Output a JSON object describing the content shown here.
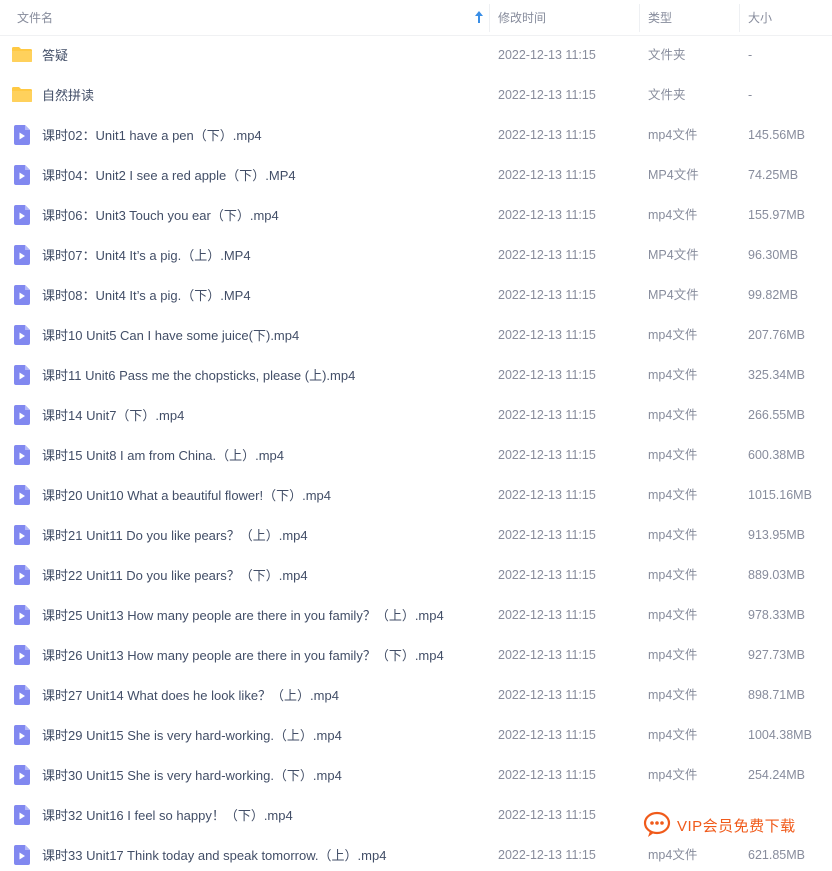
{
  "header": {
    "name_label": "文件名",
    "time_label": "修改时间",
    "type_label": "类型",
    "size_label": "大小",
    "sort_direction": "ascending"
  },
  "colors": {
    "folder": "#ffc943",
    "video_icon": "#8188f0",
    "name_text": "#424e67",
    "meta_text": "#878c9c",
    "sort_arrow": "#3a8ee6",
    "watermark": "#f05a1a"
  },
  "files": [
    {
      "kind": "folder",
      "icon": "folder-icon",
      "name": "答疑",
      "time": "2022-12-13 11:15",
      "type": "文件夹",
      "size": "-"
    },
    {
      "kind": "folder",
      "icon": "folder-icon",
      "name": "自然拼读",
      "time": "2022-12-13 11:15",
      "type": "文件夹",
      "size": "-"
    },
    {
      "kind": "video",
      "icon": "video-file-icon",
      "name": "课时02：Unit1 have a pen（下）.mp4",
      "time": "2022-12-13 11:15",
      "type": "mp4文件",
      "size": "145.56MB"
    },
    {
      "kind": "video",
      "icon": "video-file-icon",
      "name": "课时04：Unit2 I see a red apple（下）.MP4",
      "time": "2022-12-13 11:15",
      "type": "MP4文件",
      "size": "74.25MB"
    },
    {
      "kind": "video",
      "icon": "video-file-icon",
      "name": "课时06：Unit3 Touch you ear（下）.mp4",
      "time": "2022-12-13 11:15",
      "type": "mp4文件",
      "size": "155.97MB"
    },
    {
      "kind": "video",
      "icon": "video-file-icon",
      "name": "课时07：Unit4 It’s a pig.（上）.MP4",
      "time": "2022-12-13 11:15",
      "type": "MP4文件",
      "size": "96.30MB"
    },
    {
      "kind": "video",
      "icon": "video-file-icon",
      "name": "课时08：Unit4 It’s a pig.（下）.MP4",
      "time": "2022-12-13 11:15",
      "type": "MP4文件",
      "size": "99.82MB"
    },
    {
      "kind": "video",
      "icon": "video-file-icon",
      "name": "课时10 Unit5 Can I have some juice(下).mp4",
      "time": "2022-12-13 11:15",
      "type": "mp4文件",
      "size": "207.76MB"
    },
    {
      "kind": "video",
      "icon": "video-file-icon",
      "name": "课时11 Unit6 Pass me the chopsticks, please (上).mp4",
      "time": "2022-12-13 11:15",
      "type": "mp4文件",
      "size": "325.34MB"
    },
    {
      "kind": "video",
      "icon": "video-file-icon",
      "name": "课时14 Unit7（下）.mp4",
      "time": "2022-12-13 11:15",
      "type": "mp4文件",
      "size": "266.55MB"
    },
    {
      "kind": "video",
      "icon": "video-file-icon",
      "name": "课时15 Unit8 I am from China.（上）.mp4",
      "time": "2022-12-13 11:15",
      "type": "mp4文件",
      "size": "600.38MB"
    },
    {
      "kind": "video",
      "icon": "video-file-icon",
      "name": "课时20 Unit10 What a beautiful flower!（下）.mp4",
      "time": "2022-12-13 11:15",
      "type": "mp4文件",
      "size": "1015.16MB"
    },
    {
      "kind": "video",
      "icon": "video-file-icon",
      "name": "课时21 Unit11 Do you like pears？（上）.mp4",
      "time": "2022-12-13 11:15",
      "type": "mp4文件",
      "size": "913.95MB"
    },
    {
      "kind": "video",
      "icon": "video-file-icon",
      "name": "课时22 Unit11 Do you like pears？（下）.mp4",
      "time": "2022-12-13 11:15",
      "type": "mp4文件",
      "size": "889.03MB"
    },
    {
      "kind": "video",
      "icon": "video-file-icon",
      "name": "课时25 Unit13 How many people are there in you family？（上）.mp4",
      "time": "2022-12-13 11:15",
      "type": "mp4文件",
      "size": "978.33MB"
    },
    {
      "kind": "video",
      "icon": "video-file-icon",
      "name": "课时26 Unit13 How many people are there in you family？（下）.mp4",
      "time": "2022-12-13 11:15",
      "type": "mp4文件",
      "size": "927.73MB"
    },
    {
      "kind": "video",
      "icon": "video-file-icon",
      "name": "课时27 Unit14 What does he look like？（上）.mp4",
      "time": "2022-12-13 11:15",
      "type": "mp4文件",
      "size": "898.71MB"
    },
    {
      "kind": "video",
      "icon": "video-file-icon",
      "name": "课时29 Unit15 She is very hard-working.（上）.mp4",
      "time": "2022-12-13 11:15",
      "type": "mp4文件",
      "size": "1004.38MB"
    },
    {
      "kind": "video",
      "icon": "video-file-icon",
      "name": "课时30 Unit15 She is very hard-working.（下）.mp4",
      "time": "2022-12-13 11:15",
      "type": "mp4文件",
      "size": "254.24MB"
    },
    {
      "kind": "video",
      "icon": "video-file-icon",
      "name": "课时32 Unit16 I feel so happy！（下）.mp4",
      "time": "2022-12-13 11:15",
      "type": "",
      "size": ""
    },
    {
      "kind": "video",
      "icon": "video-file-icon",
      "name": "课时33 Unit17 Think today and speak tomorrow.（上）.mp4",
      "time": "2022-12-13 11:15",
      "type": "mp4文件",
      "size": "621.85MB"
    }
  ],
  "watermark": {
    "icon": "chat-bubble-icon",
    "text": "VIP会员免费下载"
  }
}
